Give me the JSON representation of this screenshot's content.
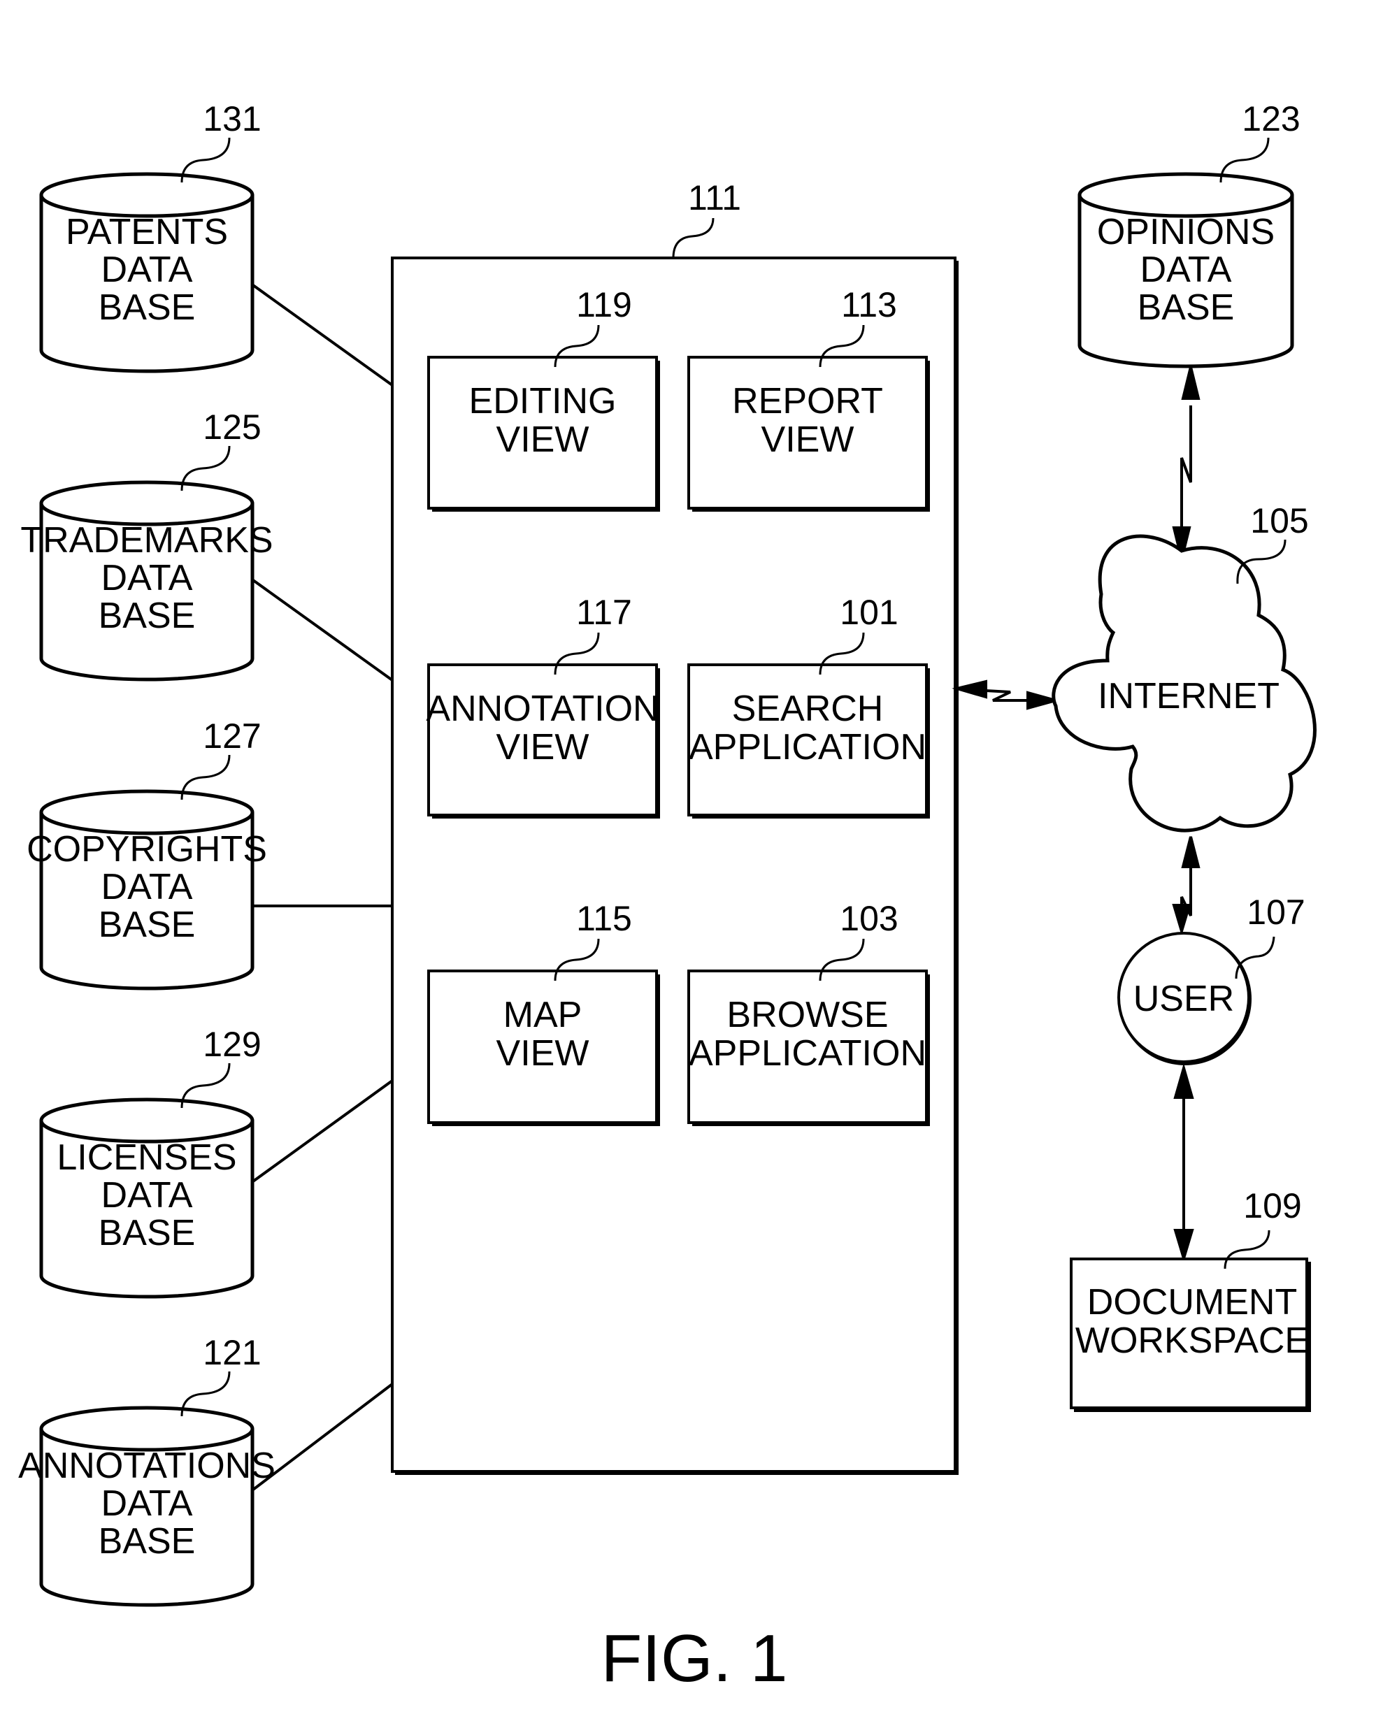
{
  "figure": {
    "caption": "FIG. 1",
    "system": {
      "ref": "111"
    },
    "databases_left": [
      {
        "ref": "131",
        "lines": [
          "PATENTS",
          "DATA",
          "BASE"
        ]
      },
      {
        "ref": "125",
        "lines": [
          "TRADEMARKS",
          "DATA",
          "BASE"
        ]
      },
      {
        "ref": "127",
        "lines": [
          "COPYRIGHTS",
          "DATA",
          "BASE"
        ]
      },
      {
        "ref": "129",
        "lines": [
          "LICENSES",
          "DATA",
          "BASE"
        ]
      },
      {
        "ref": "121",
        "lines": [
          "ANNOTATIONS",
          "DATA",
          "BASE"
        ]
      }
    ],
    "modules": [
      {
        "ref": "119",
        "lines": [
          "EDITING",
          "VIEW"
        ]
      },
      {
        "ref": "113",
        "lines": [
          "REPORT",
          "VIEW"
        ]
      },
      {
        "ref": "117",
        "lines": [
          "ANNOTATION",
          "VIEW"
        ]
      },
      {
        "ref": "101",
        "lines": [
          "SEARCH",
          "APPLICATION"
        ]
      },
      {
        "ref": "115",
        "lines": [
          "MAP",
          "VIEW"
        ]
      },
      {
        "ref": "103",
        "lines": [
          "BROWSE",
          "APPLICATION"
        ]
      }
    ],
    "opinions_db": {
      "ref": "123",
      "lines": [
        "OPINIONS",
        "DATA",
        "BASE"
      ]
    },
    "internet": {
      "ref": "105",
      "label": "INTERNET"
    },
    "user": {
      "ref": "107",
      "label": "USER"
    },
    "workspace": {
      "ref": "109",
      "lines": [
        "DOCUMENT",
        "WORKSPACE"
      ]
    }
  }
}
